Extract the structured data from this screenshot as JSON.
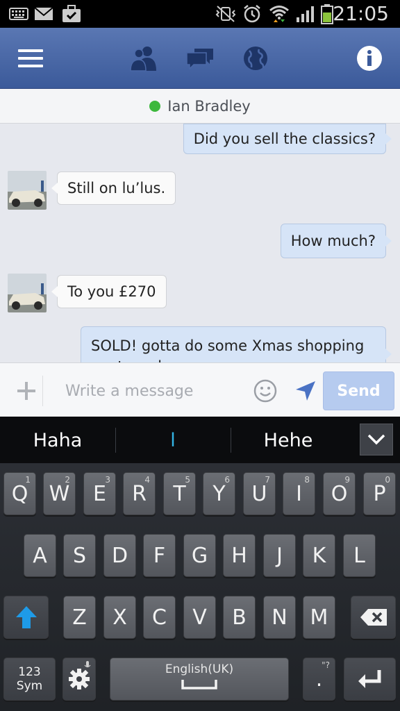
{
  "status_bar": {
    "time": "21:05",
    "left_icons": [
      "keyboard-icon",
      "mail-icon",
      "briefcase-check-icon"
    ],
    "right_icons": [
      "vibrate-mute-icon",
      "alarm-icon",
      "wifi-icon",
      "signal-icon",
      "battery-icon"
    ]
  },
  "header": {
    "icons": [
      "menu-icon",
      "friends-icon",
      "messages-icon",
      "globe-icon",
      "info-icon"
    ],
    "color": "#3b5a9a"
  },
  "conversation": {
    "contact_name": "Ian Bradley",
    "online_color": "#3cb83c",
    "messages": [
      {
        "direction": "out",
        "text": "Did you sell the classics?"
      },
      {
        "direction": "in",
        "text": "Still on lu’lus."
      },
      {
        "direction": "out",
        "text": "How much?"
      },
      {
        "direction": "in",
        "text": "To you £270"
      },
      {
        "direction": "out",
        "text": "SOLD! gotta do some Xmas shopping next week so"
      }
    ]
  },
  "composer": {
    "placeholder": "Write a message",
    "send_label": "Send"
  },
  "suggestions": {
    "items": [
      "Haha",
      "l",
      "Hehe"
    ]
  },
  "keyboard": {
    "row1": [
      {
        "key": "Q",
        "hint": "1"
      },
      {
        "key": "W",
        "hint": "2"
      },
      {
        "key": "E",
        "hint": "3"
      },
      {
        "key": "R",
        "hint": "4"
      },
      {
        "key": "T",
        "hint": "5"
      },
      {
        "key": "Y",
        "hint": "6"
      },
      {
        "key": "U",
        "hint": "7"
      },
      {
        "key": "I",
        "hint": "8"
      },
      {
        "key": "O",
        "hint": "9"
      },
      {
        "key": "P",
        "hint": "0"
      }
    ],
    "row2": [
      "A",
      "S",
      "D",
      "F",
      "G",
      "H",
      "J",
      "K",
      "L"
    ],
    "row3": [
      "Z",
      "X",
      "C",
      "V",
      "B",
      "N",
      "M"
    ],
    "sym_label_1": "123",
    "sym_label_2": "Sym",
    "space_label": "English(UK)",
    "punct_hint": "\"?",
    "punct_key": "."
  }
}
